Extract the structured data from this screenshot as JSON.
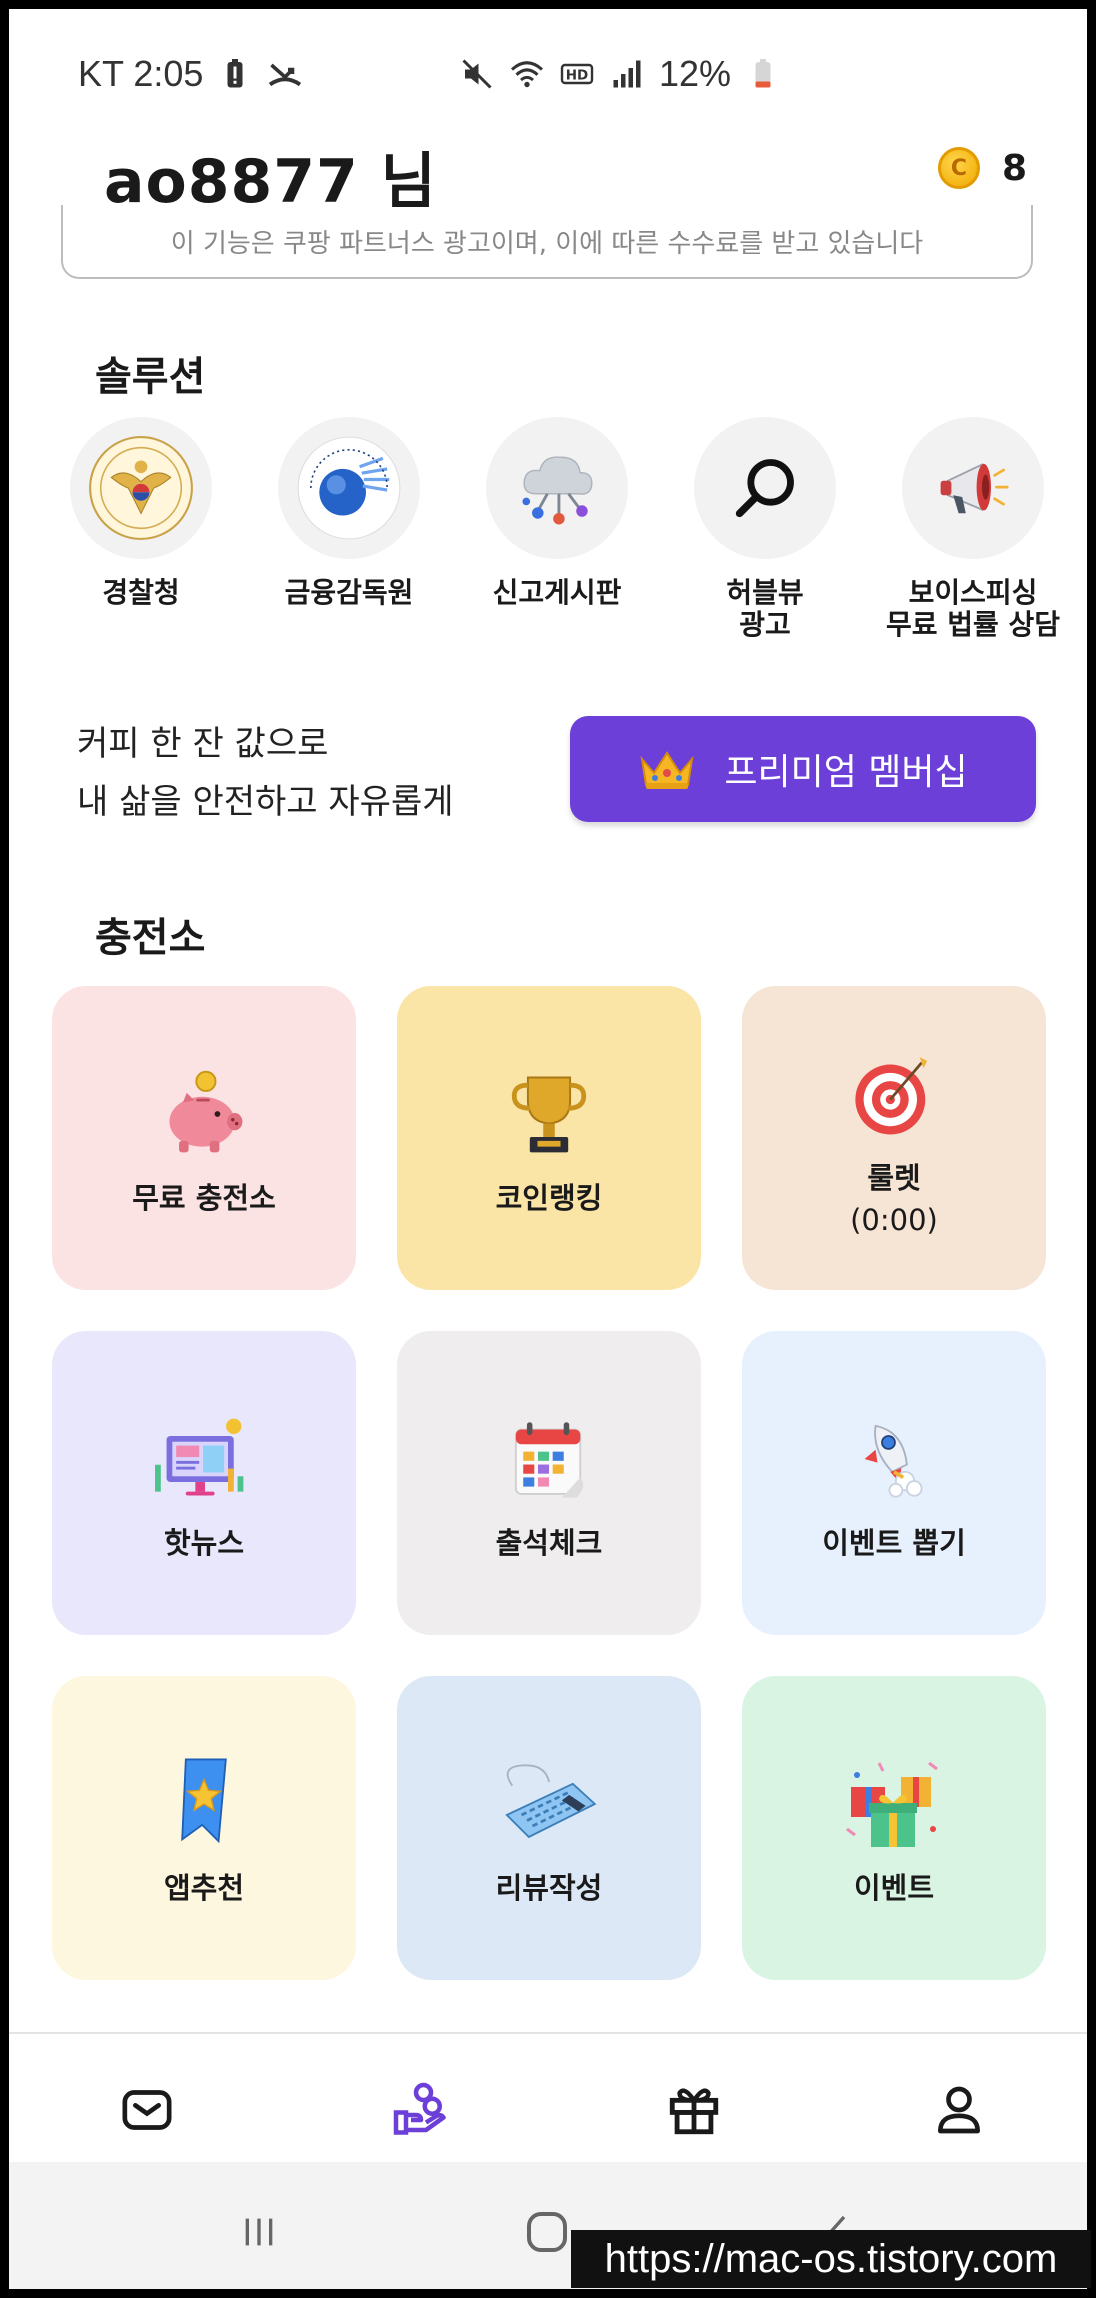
{
  "status_bar": {
    "carrier_time": "KT 2:05",
    "battery": "12%"
  },
  "header": {
    "username": "ao8877 님",
    "coin_symbol": "C",
    "coin_count": "8"
  },
  "disclaimer": "이 기능은 쿠팡 파트너스 광고이며, 이에 따른 수수료를 받고 있습니다",
  "solutions": {
    "title": "솔루션",
    "items": [
      {
        "label": "경찰청",
        "icon": "police-emblem-icon"
      },
      {
        "label": "금융감독원",
        "icon": "fss-logo-icon"
      },
      {
        "label": "신고게시판",
        "icon": "cloud-network-icon"
      },
      {
        "label": "허블뷰\n광고",
        "icon": "search-icon"
      },
      {
        "label": "보이스피싱\n무료 법률 상담",
        "icon": "megaphone-icon"
      }
    ]
  },
  "premium": {
    "line1": "커피 한 잔 값으로",
    "line2": "내 삶을 안전하고 자유롭게",
    "button_label": "프리미엄 멤버십"
  },
  "charging": {
    "title": "충전소",
    "items": [
      {
        "label": "무료 충전소",
        "sub": "",
        "bg": "#fbe3e3",
        "icon": "piggy-bank-icon"
      },
      {
        "label": "코인랭킹",
        "sub": "",
        "bg": "#fbe5a6",
        "icon": "trophy-icon"
      },
      {
        "label": "룰렛",
        "sub": "(0:00)",
        "bg": "#f6e4d4",
        "icon": "target-icon"
      },
      {
        "label": "핫뉴스",
        "sub": "",
        "bg": "#e8e7fb",
        "icon": "news-monitor-icon"
      },
      {
        "label": "출석체크",
        "sub": "",
        "bg": "#efedee",
        "icon": "calendar-icon"
      },
      {
        "label": "이벤트 뽑기",
        "sub": "",
        "bg": "#e7f1fd",
        "icon": "rocket-icon"
      },
      {
        "label": "앱추천",
        "sub": "",
        "bg": "#fef7df",
        "icon": "bookmark-star-icon"
      },
      {
        "label": "리뷰작성",
        "sub": "",
        "bg": "#dce8f6",
        "icon": "keyboard-icon"
      },
      {
        "label": "이벤트",
        "sub": "",
        "bg": "#d9f4e3",
        "icon": "gift-boxes-icon"
      }
    ]
  },
  "bottom_nav": [
    "mail-icon",
    "coin-hand-icon",
    "gift-icon",
    "profile-icon"
  ],
  "accent_color": "#6c3fd8",
  "watermark": "https://mac-os.tistory.com"
}
